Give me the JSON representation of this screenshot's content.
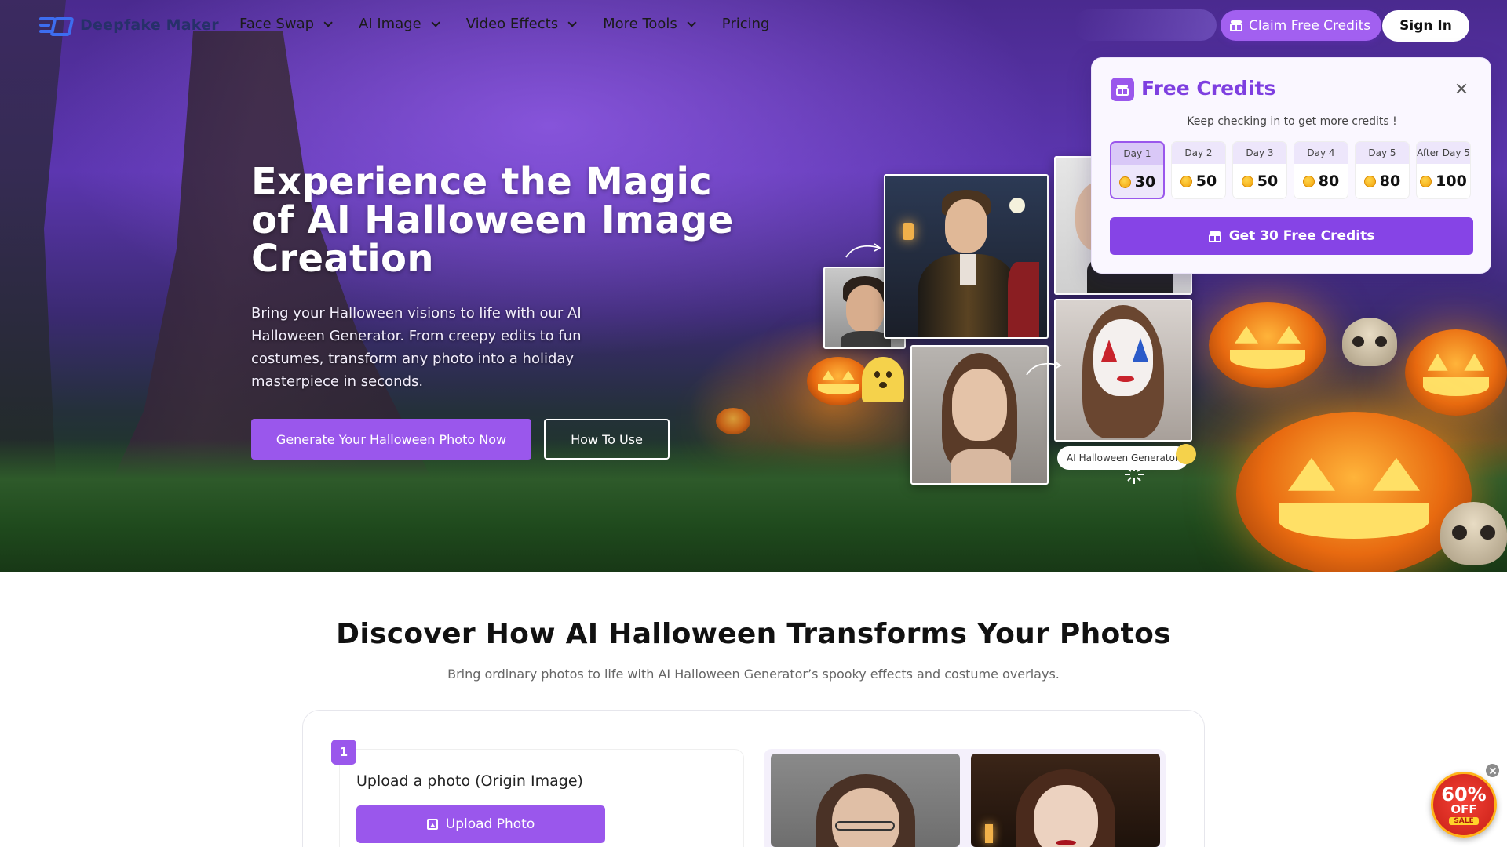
{
  "nav": {
    "logo_text": "Deepfake Maker",
    "menu": [
      {
        "label": "Face Swap",
        "has_dropdown": true
      },
      {
        "label": "AI Image",
        "has_dropdown": true
      },
      {
        "label": "Video Effects",
        "has_dropdown": true
      },
      {
        "label": "More Tools",
        "has_dropdown": true
      },
      {
        "label": "Pricing",
        "has_dropdown": false
      }
    ],
    "claim_label": "Claim Free Credits",
    "signin_label": "Sign In"
  },
  "hero": {
    "title": "Experience the Magic of AI Halloween Image Creation",
    "description": "Bring your Halloween visions to life with our AI Halloween Generator. From creepy edits to fun costumes, transform any photo into a holiday masterpiece in seconds.",
    "primary_cta": "Generate Your Halloween Photo Now",
    "secondary_cta": "How To Use",
    "collage_label": "AI Halloween Generator"
  },
  "credits_popup": {
    "title": "Free Credits",
    "subtitle": "Keep checking in to get more credits !",
    "days": [
      {
        "label": "Day 1",
        "value": "30",
        "active": true
      },
      {
        "label": "Day 2",
        "value": "50",
        "active": false
      },
      {
        "label": "Day 3",
        "value": "50",
        "active": false
      },
      {
        "label": "Day 4",
        "value": "80",
        "active": false
      },
      {
        "label": "Day 5",
        "value": "80",
        "active": false
      },
      {
        "label": "After Day 5",
        "value": "100",
        "active": false
      }
    ],
    "button_label": "Get 30 Free Credits"
  },
  "section": {
    "title": "Discover How AI Halloween Transforms Your Photos",
    "subtitle": "Bring ordinary photos to life with AI Halloween Generator’s spooky effects and costume overlays.",
    "step_number": "1",
    "step_label": "Upload a photo (Origin Image)",
    "upload_button": "Upload Photo"
  },
  "promo": {
    "percent": "60%",
    "off": "OFF",
    "sale": "SALE"
  },
  "colors": {
    "accent": "#9a57ec",
    "accent_dark": "#7e3fe0",
    "logo": "#3d6df0"
  }
}
